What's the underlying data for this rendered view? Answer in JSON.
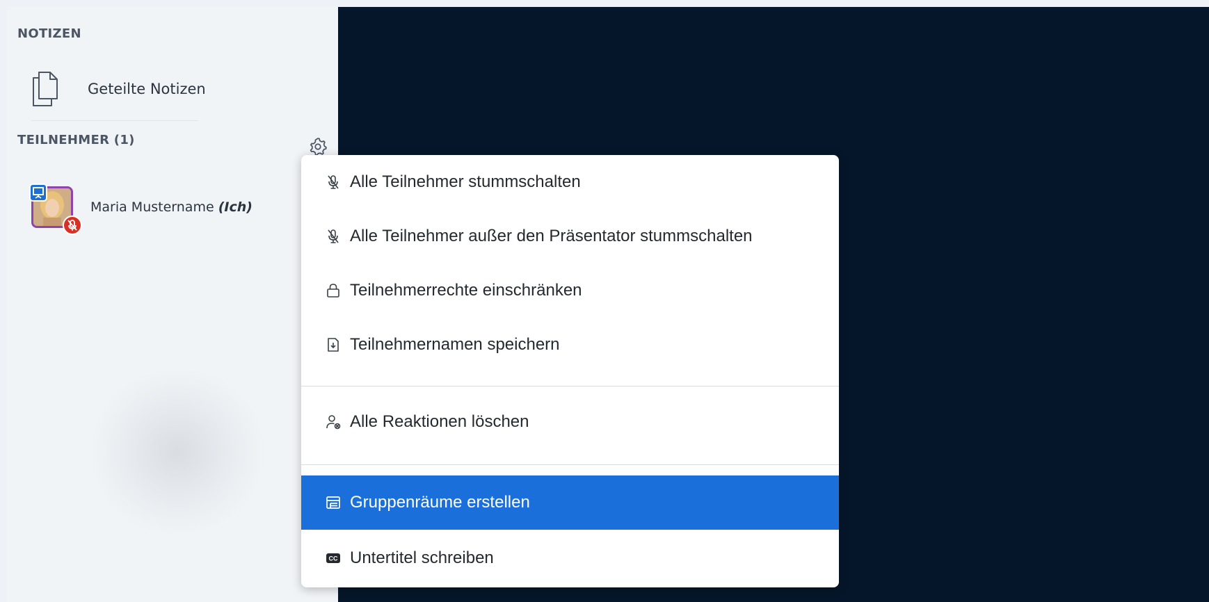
{
  "notes": {
    "section_title": "NOTIZEN",
    "shared_notes_label": "Geteilte Notizen"
  },
  "participants": {
    "section_title": "TEILNEHMER (1)",
    "user": {
      "name": "Maria Mustername",
      "you_label": "(Ich)"
    }
  },
  "menu": {
    "items": [
      {
        "label": "Alle Teilnehmer stummschalten",
        "icon": "mute-icon"
      },
      {
        "label": "Alle Teilnehmer außer den Präsentator stummschalten",
        "icon": "mute-icon"
      },
      {
        "label": "Teilnehmerrechte einschränken",
        "icon": "lock-icon"
      },
      {
        "label": "Teilnehmernamen speichern",
        "icon": "file-download-icon"
      },
      {
        "label": "Alle Reaktionen löschen",
        "icon": "clear-status-icon"
      },
      {
        "label": "Gruppenräume erstellen",
        "icon": "rooms-icon",
        "active": true
      },
      {
        "label": "Untertitel schreiben",
        "icon": "closed-captions-icon"
      }
    ]
  },
  "colors": {
    "accent": "#1a6fdb",
    "main_background": "#06162a",
    "sidebar_background": "#f1f4f7",
    "presenter_badge": "#1d6fd1",
    "muted_badge": "#d93025",
    "avatar_border": "#8e44ad"
  }
}
